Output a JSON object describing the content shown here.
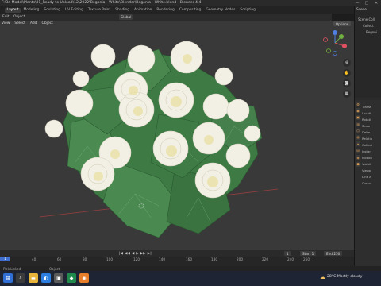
{
  "window": {
    "title": "F:\\3d Model\\Plants\\01_Ready to Upload\\12\\2022\\Begonia - White\\Blender\\Begonia - White.blend - Blender 4.4",
    "controls": [
      "—",
      "□",
      "✕"
    ]
  },
  "workspaces": [
    "Layout",
    "Modeling",
    "Sculpting",
    "UV Editing",
    "Texture Paint",
    "Shading",
    "Animation",
    "Rendering",
    "Compositing",
    "Geometry Nodes",
    "Scripting"
  ],
  "toolbar": {
    "mode": "Edit",
    "object": "Object",
    "transform": "Global"
  },
  "viewport": {
    "menu": [
      "View",
      "Select",
      "Add",
      "Object"
    ],
    "options": "Options",
    "gizmo": {
      "x": "X",
      "y": "Y",
      "z": "Z"
    },
    "nav_icons": [
      "zoom-icon",
      "hand-icon",
      "camera-icon",
      "grid-icon"
    ]
  },
  "timeline": {
    "controls": [
      "|◀",
      "◀◀",
      "◀",
      "▶",
      "▶▶",
      "▶|"
    ],
    "current_frame": "1",
    "start": "Start",
    "start_value": "1",
    "end": "End",
    "end_value": "250",
    "ticks": [
      "40",
      "60",
      "80",
      "100",
      "120",
      "140",
      "160",
      "180",
      "200",
      "220",
      "240",
      "250"
    ],
    "playhead": "1"
  },
  "outliner": {
    "header": "Scene",
    "rows": [
      "Scene Coll",
      "Collect",
      "Begoni"
    ]
  },
  "properties": {
    "tabs": [
      "⚙",
      "◉",
      "▣",
      "⊞",
      "⬡",
      "◍",
      "✦",
      "⛁",
      "◈",
      "⬢"
    ],
    "rows": [
      "Transf",
      "Locati",
      "Rotati",
      "Scale",
      "Delta",
      "Relatio",
      "Collect",
      "Instan",
      "Motion",
      "Visibil",
      "Viewp",
      "Line A",
      "Custo"
    ]
  },
  "status": {
    "left": "Pick Linked",
    "mid": "Object"
  },
  "taskbar": {
    "temp": "28°C",
    "weather": "Mostly cloudy"
  },
  "colors": {
    "accent": "#3f6fd1",
    "viewport_bg": "#393939",
    "leaf": "#3f7b45",
    "flower": "#f2efe4"
  }
}
